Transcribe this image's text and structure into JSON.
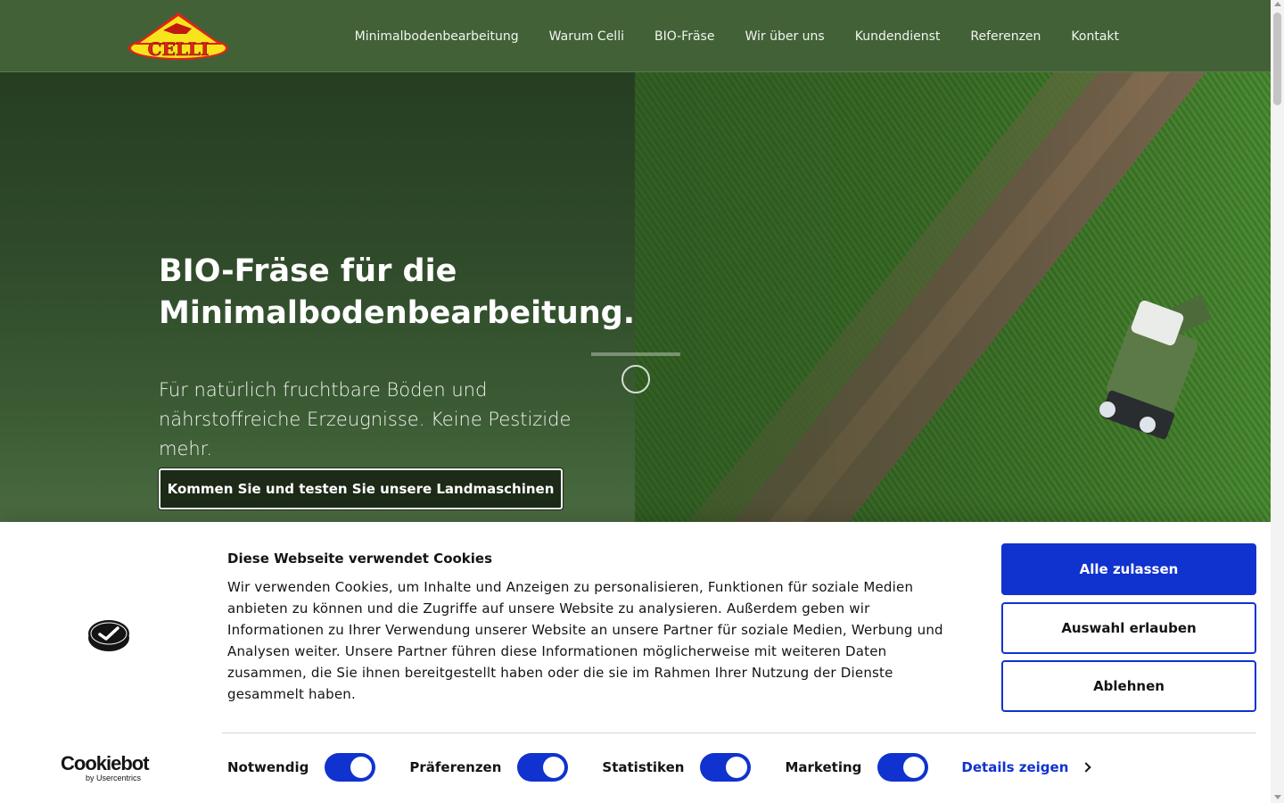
{
  "header": {
    "logo_text": "CELLI",
    "nav": [
      {
        "label": "Minimalbodenbearbeitung"
      },
      {
        "label": "Warum Celli"
      },
      {
        "label": "BIO-Fräse"
      },
      {
        "label": "Wir über uns"
      },
      {
        "label": "Kundendienst"
      },
      {
        "label": "Referenzen"
      },
      {
        "label": "Kontakt"
      }
    ]
  },
  "hero": {
    "title_line1": "BIO-Fräse für die",
    "title_line2": "Minimalbodenbearbeitung.",
    "subtitle_line1": "Für natürlich fruchtbare Böden und",
    "subtitle_line2": "nährstoffreiche Erzeugnisse. Keine Pestizide mehr.",
    "cta_label": "Kommen Sie und testen Sie unsere Landmaschinen"
  },
  "cookie": {
    "title": "Diese Webseite verwendet Cookies",
    "text": "Wir verwenden Cookies, um Inhalte und Anzeigen zu personalisieren, Funktionen für soziale Medien anbieten zu können und die Zugriffe auf unsere Website zu analysieren. Außerdem geben wir Informationen zu Ihrer Verwendung unserer Website an unsere Partner für soziale Medien, Werbung und Analysen weiter. Unsere Partner führen diese Informationen möglicherweise mit weiteren Daten zusammen, die Sie ihnen bereitgestellt haben oder die sie im Rahmen Ihrer Nutzung der Dienste gesammelt haben.",
    "btn_allow_all": "Alle zulassen",
    "btn_allow_selection": "Auswahl erlauben",
    "btn_deny": "Ablehnen",
    "toggles": [
      {
        "label": "Notwendig",
        "on": true
      },
      {
        "label": "Präferenzen",
        "on": true
      },
      {
        "label": "Statistiken",
        "on": true
      },
      {
        "label": "Marketing",
        "on": true
      }
    ],
    "details_label": "Details zeigen",
    "brand_main": "Cookiebot",
    "brand_sub": "by Usercentrics",
    "accent_color": "#1032cf"
  },
  "colors": {
    "header_bg": "#426137",
    "hero_bg": "#2f4a2a"
  }
}
